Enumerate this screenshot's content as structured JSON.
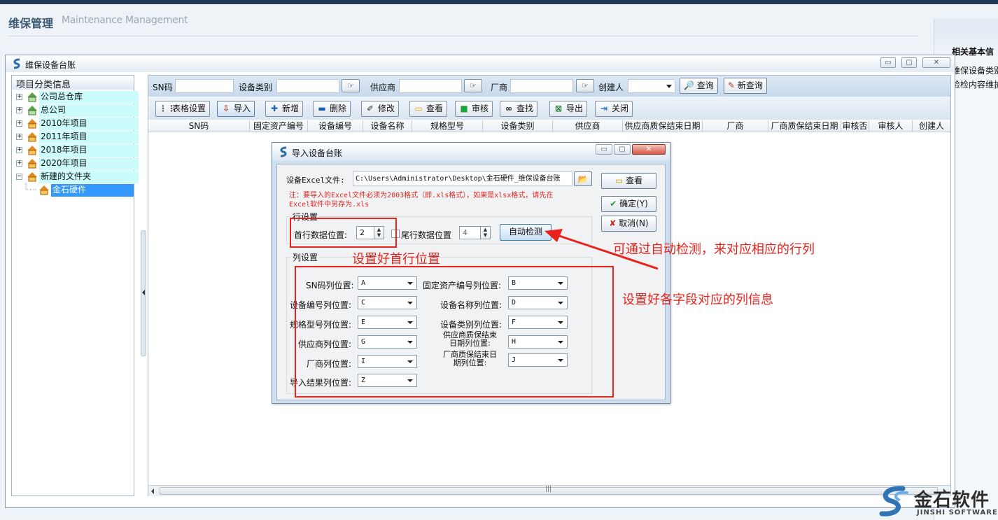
{
  "page": {
    "title": "维保管理",
    "subtitle": "Maintenance Management"
  },
  "side_panel": {
    "title": "相关基本信",
    "items": [
      "维保设备类别",
      "检检内容维护"
    ]
  },
  "window": {
    "title": "维保设备台账",
    "min_label": "▭",
    "max_label": "▢",
    "close_label": "✕"
  },
  "tree": {
    "header": "项目分类信息",
    "nodes": [
      {
        "label": "公司总仓库"
      },
      {
        "label": "总公司"
      },
      {
        "label": "2010年项目"
      },
      {
        "label": "2011年项目"
      },
      {
        "label": "2018年项目"
      },
      {
        "label": "2020年项目"
      },
      {
        "label": "新建的文件夹"
      },
      {
        "label": "金石硬件"
      }
    ]
  },
  "query": {
    "sn_label": "SN码",
    "category_label": "设备类别",
    "supplier_label": "供应商",
    "vendor_label": "厂商",
    "creator_label": "创建人",
    "search_btn": "查询",
    "new_query_btn": "新查询"
  },
  "toolbar": {
    "grid_settings": "表格设置",
    "import": "导入",
    "add": "新增",
    "delete": "删除",
    "edit": "修改",
    "view": "查看",
    "audit": "审核",
    "find": "查找",
    "export": "导出",
    "close": "关闭"
  },
  "grid": {
    "columns": [
      "SN码",
      "固定资产编号",
      "设备编号",
      "设备名称",
      "规格型号",
      "设备类别",
      "供应商",
      "供应商质保结束日期",
      "厂商",
      "厂商质保结束日期",
      "审核否",
      "审核人",
      "创建人"
    ]
  },
  "dialog": {
    "title": "导入设备台账",
    "file_label": "设备Excel文件:",
    "file_path": "C:\\Users\\Administrator\\Desktop\\金石硬件_维保设备台账",
    "note_line1": "注：要导入的Excel文件必须为2003格式（即.xls格式），如果是xlsx格式，请先在",
    "note_line2": "Excel软件中另存为.xls",
    "row_group": "行设置",
    "first_row_label": "首行数据位置:",
    "first_row_value": "2",
    "last_row_label": "尾行数据位置",
    "last_row_value": "4",
    "auto_detect_btn": "自动检测",
    "col_group": "列设置",
    "view_btn": "查看",
    "ok_btn": "确定(Y)",
    "cancel_btn": "取消(N)",
    "columns": [
      {
        "label": "SN码列位置:",
        "value": "A"
      },
      {
        "label": "固定资产编号列位置:",
        "value": "B"
      },
      {
        "label": "设备编号列位置:",
        "value": "C"
      },
      {
        "label": "设备名称列位置:",
        "value": "D"
      },
      {
        "label": "规格型号列位置:",
        "value": "E"
      },
      {
        "label": "设备类别列位置:",
        "value": "F"
      },
      {
        "label": "供应商列位置:",
        "value": "G"
      },
      {
        "label1": "供应商质保结束",
        "label2": "日期列位置:",
        "value": "H"
      },
      {
        "label": "厂商列位置:",
        "value": "I"
      },
      {
        "label1": "厂商质保结束日",
        "label2": "期列位置:",
        "value": "J"
      },
      {
        "label": "导入结果列位置:",
        "value": "Z"
      }
    ]
  },
  "annotations": {
    "first_row": "设置好首行位置",
    "auto_detect": "可通过自动检测，来对应相应的行列",
    "columns": "设置好各字段对应的列信息"
  },
  "logo": {
    "cn": "金石软件",
    "en": "JINSHI SOFTWARE"
  },
  "colors": {
    "accent_red": "#e8231c",
    "tree_highlight": "#ccfbfb",
    "tree_selected": "#3399ff",
    "header_bar": "#1e3a56"
  }
}
